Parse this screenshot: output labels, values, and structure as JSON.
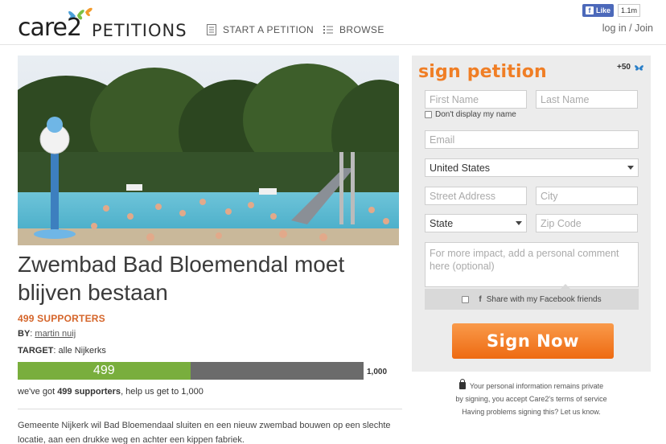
{
  "header": {
    "logo_text": "care2",
    "logo_suffix": "PETITIONS",
    "nav": [
      {
        "label": "START A PETITION"
      },
      {
        "label": "BROWSE"
      }
    ],
    "fb_like_label": "Like",
    "fb_like_count": "1.1m",
    "login_text": "log in / Join"
  },
  "petition": {
    "title": "Zwembad Bad Bloemendal moet blijven bestaan",
    "supporters_text": "499 SUPPORTERS",
    "by_label": "BY",
    "by_name": "martin nuij",
    "target_label": "TARGET",
    "target_value": "alle Nijkerks",
    "progress": {
      "current": 499,
      "current_label": "499",
      "goal": 1000,
      "goal_label": "1,000"
    },
    "progress_note_pre": "we've got ",
    "progress_note_bold": "499 supporters",
    "progress_note_post": ", help us get to 1,000",
    "description": "Gemeente Nijkerk wil Bad Bloemendaal sluiten en een nieuw zwembad bouwen op een slechte locatie, aan een drukke weg en achter een kippen fabriek."
  },
  "sign_form": {
    "title": "sign petition",
    "points": "+50",
    "first_name_placeholder": "First Name",
    "last_name_placeholder": "Last Name",
    "dont_display_label": "Don't display my name",
    "email_placeholder": "Email",
    "country_value": "United States",
    "street_placeholder": "Street Address",
    "city_placeholder": "City",
    "state_value": "State",
    "zip_placeholder": "Zip Code",
    "comment_placeholder": "For more impact, add a personal comment here (optional)",
    "fb_share_label": "Share with my Facebook friends",
    "submit_label": "Sign Now"
  },
  "privacy": {
    "line1": "Your personal information remains private",
    "line2": "by signing, you accept Care2's terms of service",
    "line3": "Having problems signing this? Let us know."
  },
  "colors": {
    "accent_orange": "#f07e25",
    "progress_green": "#79ae3d",
    "progress_gray": "#6b6b6b",
    "supporters_orange": "#d5652a"
  }
}
